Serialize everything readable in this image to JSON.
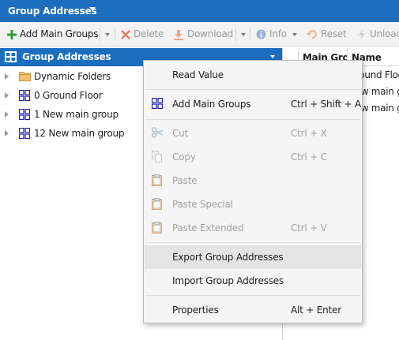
{
  "window": {
    "title": "Group Addresses"
  },
  "toolbar": {
    "add_main_groups": "Add Main Groups",
    "delete": "Delete",
    "download": "Download",
    "info": "Info",
    "reset": "Reset",
    "unload": "Unload"
  },
  "tree": {
    "header": "Group Addresses",
    "items": [
      {
        "label": "Dynamic Folders",
        "icon": "folder-icon"
      },
      {
        "label": "0 Ground Floor",
        "icon": "group-grid-icon"
      },
      {
        "label": "1 New main group",
        "icon": "group-grid-icon"
      },
      {
        "label": "12 New main group",
        "icon": "group-grid-icon"
      }
    ]
  },
  "table": {
    "columns": [
      "Main Group",
      "Name"
    ],
    "rows": [
      "Ground Floor",
      "New main gr",
      "New main gr"
    ]
  },
  "context_menu": {
    "items": [
      {
        "label": "Read Value",
        "shortcut": "",
        "enabled": true
      },
      {
        "label": "Add Main Groups",
        "shortcut": "Ctrl + Shift + A",
        "enabled": true
      },
      {
        "label": "Cut",
        "shortcut": "Ctrl + X",
        "enabled": false
      },
      {
        "label": "Copy",
        "shortcut": "Ctrl + C",
        "enabled": false
      },
      {
        "label": "Paste",
        "shortcut": "",
        "enabled": false
      },
      {
        "label": "Paste Special",
        "shortcut": "",
        "enabled": false
      },
      {
        "label": "Paste Extended",
        "shortcut": "Ctrl + V",
        "enabled": false
      },
      {
        "label": "Export Group Addresses",
        "shortcut": "",
        "enabled": true
      },
      {
        "label": "Import Group Addresses",
        "shortcut": "",
        "enabled": true
      },
      {
        "label": "Properties",
        "shortcut": "Alt + Enter",
        "enabled": true
      }
    ],
    "hovered": "Export Group Addresses"
  },
  "colors": {
    "accent": "#1c6dbd",
    "menu_bg": "#f5f5f5",
    "hover": "#e4e4e4",
    "disabled": "#a0a0a0"
  }
}
